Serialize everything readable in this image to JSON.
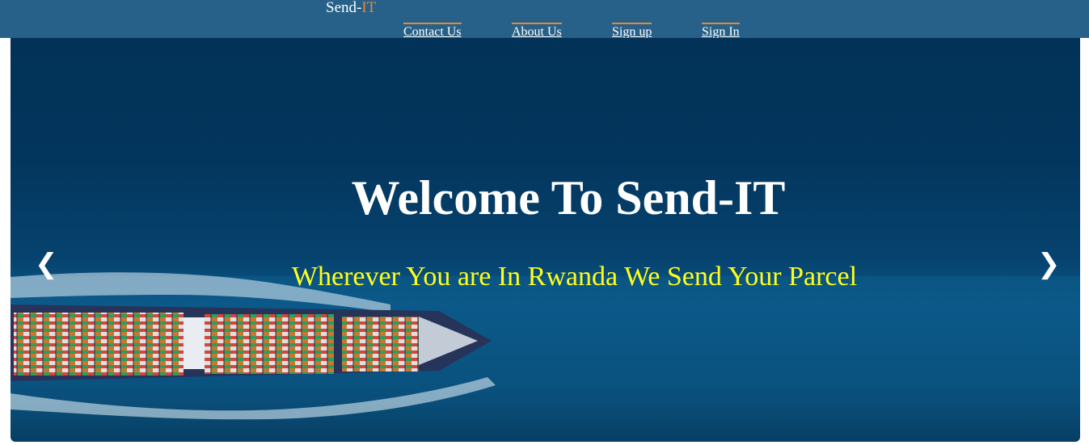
{
  "navbar": {
    "brand_prefix": "Send-",
    "brand_accent": "IT",
    "links": [
      "Contact Us",
      "About Us",
      "Sign up",
      "Sign In"
    ]
  },
  "hero": {
    "title": "Welcome To Send-IT",
    "subtitle": "Wherever You are In Rwanda We Send Your Parcel",
    "prev_icon": "❮",
    "next_icon": "❯"
  },
  "colors": {
    "navbar_bg": "#276088",
    "accent": "#e8892e",
    "subtitle": "#ffff1a"
  }
}
